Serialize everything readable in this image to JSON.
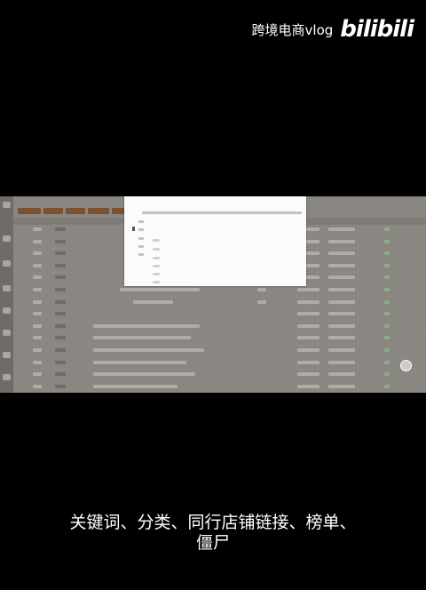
{
  "watermark": {
    "text": "跨境电商vlog",
    "logo": "bilibili"
  },
  "caption": {
    "line1": "关键词、分类、同行店铺链接、榜单、",
    "line2": "僵尸"
  },
  "colors": {
    "toolbar_button": "#7c5132",
    "screen_bg": "#8a8682",
    "dialog_bg": "#fbfbfb"
  }
}
